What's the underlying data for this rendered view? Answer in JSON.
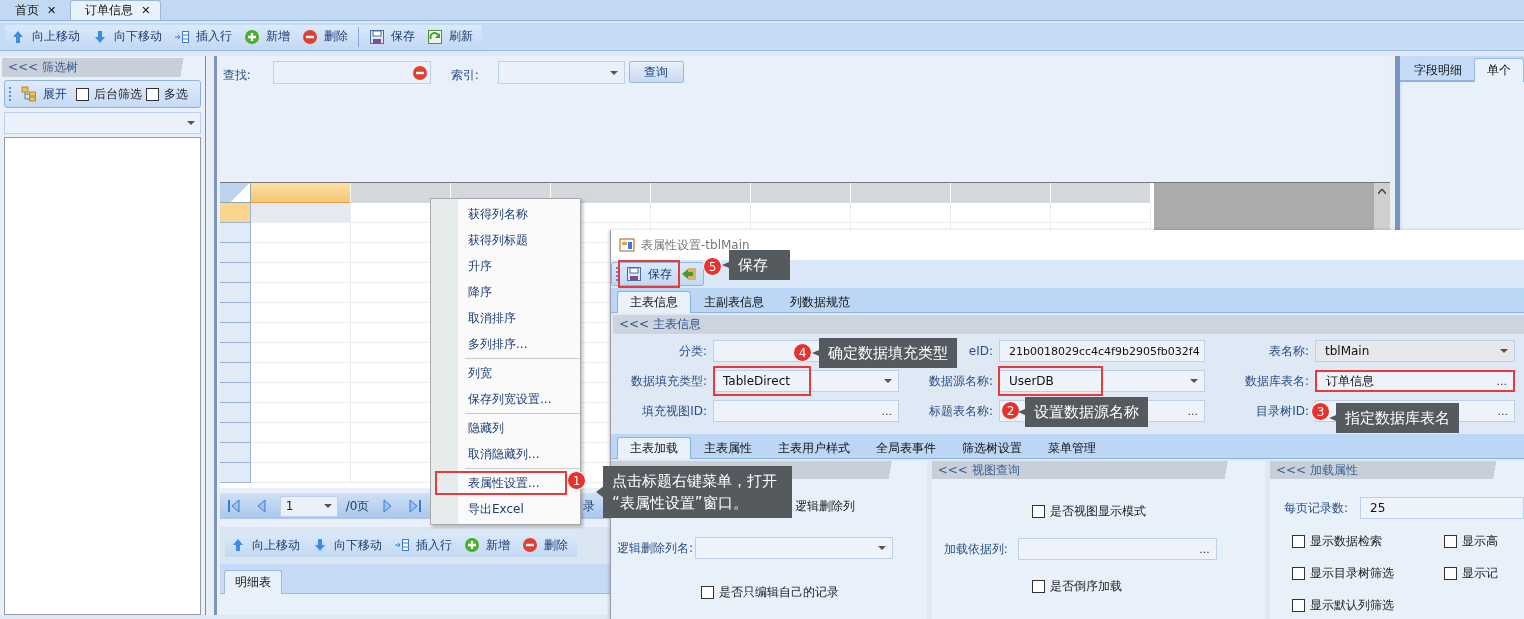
{
  "tabs": [
    {
      "label": "首页",
      "close": "✕",
      "selected": false
    },
    {
      "label": "订单信息",
      "close": "✕",
      "selected": true
    }
  ],
  "toolbar": [
    {
      "kind": "up",
      "label": "向上移动"
    },
    {
      "kind": "down",
      "label": "向下移动"
    },
    {
      "kind": "insert",
      "label": "插入行"
    },
    {
      "kind": "add",
      "label": "新增"
    },
    {
      "kind": "delete",
      "label": "删除"
    },
    {
      "kind": "sep"
    },
    {
      "kind": "save",
      "label": "保存"
    },
    {
      "kind": "refresh",
      "label": "刷新"
    }
  ],
  "filter_panel": {
    "title": "<<< 筛选树",
    "expand": "展开",
    "options": [
      {
        "label": "后台筛选",
        "checked": false
      },
      {
        "label": "多选",
        "checked": false
      }
    ]
  },
  "search": {
    "find_label": "查找:",
    "index_label": "索引:",
    "button": "查询"
  },
  "grid": {
    "columns": [
      {
        "selected": true
      },
      {
        "selected": false
      },
      {
        "selected": false
      },
      {
        "selected": false
      },
      {
        "selected": false
      },
      {
        "selected": false
      },
      {
        "selected": false
      },
      {
        "selected": false
      },
      {
        "selected": false
      }
    ],
    "pager": {
      "page": "1",
      "pages": "/0页",
      "records": "录"
    }
  },
  "detail_toolbar": [
    {
      "kind": "up",
      "label": "向上移动"
    },
    {
      "kind": "down",
      "label": "向下移动"
    },
    {
      "kind": "insert",
      "label": "插入行"
    },
    {
      "kind": "add",
      "label": "新增"
    },
    {
      "kind": "delete",
      "label": "删除"
    }
  ],
  "detail_tabs": [
    {
      "label": "明细表",
      "selected": true
    }
  ],
  "right_tabs": [
    {
      "label": "字段明细",
      "selected": false
    },
    {
      "label": "单个",
      "selected": true
    }
  ],
  "context_menu": [
    [
      {
        "label": "获得列名称",
        "highlighted": false
      },
      {
        "label": "获得列标题",
        "highlighted": false
      },
      {
        "label": "升序",
        "highlighted": false
      },
      {
        "label": "降序",
        "highlighted": false
      },
      {
        "label": "取消排序",
        "highlighted": false
      },
      {
        "label": "多列排序...",
        "highlighted": false
      }
    ],
    [
      {
        "label": "列宽",
        "highlighted": false
      },
      {
        "label": "保存列宽设置...",
        "highlighted": false
      }
    ],
    [
      {
        "label": "隐藏列",
        "highlighted": false
      },
      {
        "label": "取消隐藏列...",
        "highlighted": false
      }
    ],
    [
      {
        "label": "表属性设置...",
        "highlighted": true
      },
      {
        "label": "导出Excel",
        "highlighted": false
      }
    ]
  ],
  "dialog": {
    "title": "表属性设置-tblMain",
    "toolbar": [
      {
        "kind": "save",
        "label": "保存",
        "highlighted": true
      },
      {
        "kind": "exit",
        "highlighted": false
      }
    ],
    "tabs": [
      {
        "label": "主表信息",
        "selected": true
      },
      {
        "label": "主副表信息",
        "selected": false
      },
      {
        "label": "列数据规范",
        "selected": false
      }
    ],
    "section": "<<< 主表信息",
    "fields": [
      {
        "label": "分类:",
        "kind": "text",
        "highlighted": false
      },
      {
        "label": "eID:",
        "kind": "text",
        "value": "21b0018029cc4c4f9b2905fb032f4",
        "highlighted": false
      },
      {
        "label": "表名称:",
        "kind": "combo",
        "value": "tblMain",
        "highlighted": false
      },
      {
        "label": "数据填充类型:",
        "kind": "combo",
        "value": "TableDirect",
        "highlighted": true
      },
      {
        "label": "数据源名称:",
        "kind": "combo",
        "value": "UserDB",
        "highlighted": true
      },
      {
        "label": "数据库表名:",
        "kind": "browse",
        "value": "订单信息",
        "button": "...",
        "highlighted": true
      },
      {
        "label": "填充视图ID:",
        "kind": "browse",
        "button": "...",
        "highlighted": false
      },
      {
        "label": "标题表名称:",
        "kind": "browse",
        "button": "...",
        "highlighted": false
      },
      {
        "label": "目录树ID:",
        "kind": "browse",
        "button": "...",
        "highlighted": false
      }
    ],
    "subtabs": [
      {
        "label": "主表加载",
        "selected": true
      },
      {
        "label": "主表属性",
        "selected": false
      },
      {
        "label": "主表用户样式",
        "selected": false
      },
      {
        "label": "全局表事件",
        "selected": false
      },
      {
        "label": "筛选树设置",
        "selected": false
      },
      {
        "label": "菜单管理",
        "selected": false
      }
    ],
    "edit_panel": {
      "note": "逻辑删除列",
      "field": {
        "label": "逻辑删除列名:",
        "kind": "combo"
      },
      "check": {
        "label": "是否只编辑自己的记录",
        "checked": false
      }
    },
    "view_panel": {
      "title": "<<< 视图查询",
      "check1": {
        "label": "是否视图显示模式",
        "checked": false
      },
      "field": {
        "label": "加载依据列:",
        "kind": "browse",
        "button": "..."
      },
      "check2": {
        "label": "是否倒序加载",
        "checked": false
      }
    },
    "load_panel": {
      "title": "<<< 加载属性",
      "field": {
        "label": "每页记录数:",
        "value": "25"
      },
      "checks": [
        {
          "label": "显示数据检索",
          "checked": false
        },
        {
          "label": "显示高",
          "checked": false
        },
        {
          "label": "显示目录树筛选",
          "checked": false
        },
        {
          "label": "显示记",
          "checked": false
        },
        {
          "label": "显示默认列筛选",
          "checked": false
        }
      ]
    }
  },
  "callouts": [
    {
      "number": "1",
      "text": "点击标题右键菜单，打开\n“表属性设置”窗口。"
    },
    {
      "number": "2",
      "text": "设置数据源名称"
    },
    {
      "number": "3",
      "text": "指定数据库表名"
    },
    {
      "number": "4",
      "text": "确定数据填充类型"
    },
    {
      "number": "5",
      "text": "保存"
    }
  ]
}
